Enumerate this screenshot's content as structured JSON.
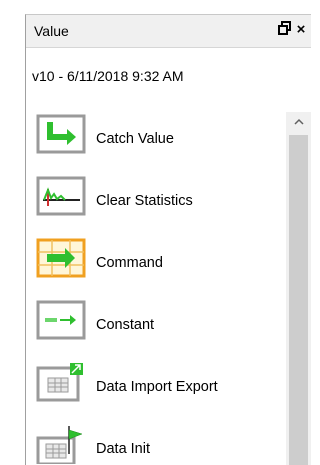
{
  "panel": {
    "title": "Value",
    "pin_icon": "pin-icon",
    "close_icon": "close-icon",
    "pin_glyph": "❐",
    "close_glyph": "×"
  },
  "version_text": "v10  -  6/11/2018 9:32 AM",
  "items": [
    {
      "label": "Catch Value",
      "icon": "catch-value-icon"
    },
    {
      "label": "Clear Statistics",
      "icon": "clear-statistics-icon"
    },
    {
      "label": "Command",
      "icon": "command-icon"
    },
    {
      "label": "Constant",
      "icon": "constant-icon"
    },
    {
      "label": "Data Import Export",
      "icon": "data-import-export-icon"
    },
    {
      "label": "Data Init",
      "icon": "data-init-icon"
    }
  ],
  "colors": {
    "accent_green": "#2fbf2f",
    "icon_frame": "#9a9a9a",
    "command_frame": "#f0a020"
  }
}
